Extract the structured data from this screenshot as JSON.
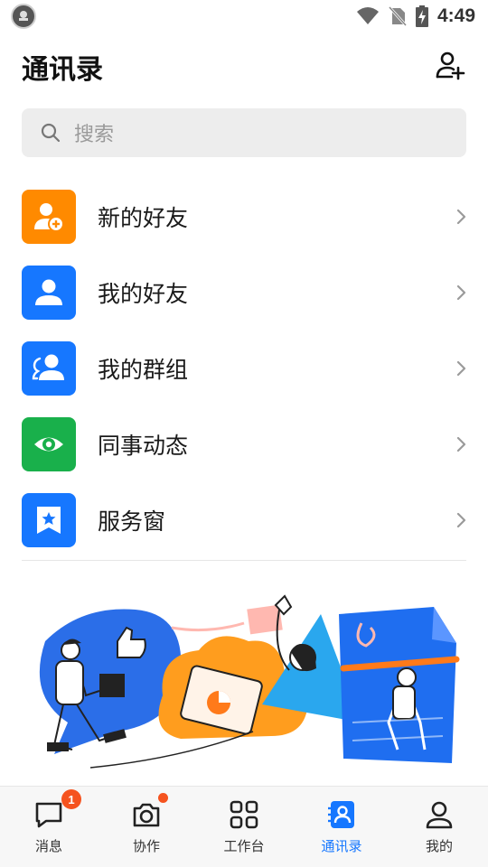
{
  "status_bar": {
    "time": "4:49",
    "icons": [
      "wifi-icon",
      "no-sim-icon",
      "battery-charging-icon"
    ]
  },
  "header": {
    "title": "通讯录",
    "add_contact_icon": "add-person-icon"
  },
  "search": {
    "placeholder": "搜索"
  },
  "menu": [
    {
      "label": "新的好友",
      "icon": "add-friend-icon",
      "color": "#ff8a00"
    },
    {
      "label": "我的好友",
      "icon": "person-icon",
      "color": "#1677ff"
    },
    {
      "label": "我的群组",
      "icon": "group-icon",
      "color": "#1677ff"
    },
    {
      "label": "同事动态",
      "icon": "eye-icon",
      "color": "#19b04b"
    },
    {
      "label": "服务窗",
      "icon": "bookmark-star-icon",
      "color": "#1677ff"
    }
  ],
  "tabs": [
    {
      "label": "消息",
      "icon": "chat-bubble-icon",
      "badge": "1"
    },
    {
      "label": "协作",
      "icon": "collaborate-icon",
      "dot": true
    },
    {
      "label": "工作台",
      "icon": "grid-icon"
    },
    {
      "label": "通讯录",
      "icon": "contacts-icon",
      "active": true
    },
    {
      "label": "我的",
      "icon": "profile-icon"
    }
  ],
  "colors": {
    "accent": "#1677ff",
    "orange": "#ff8a00",
    "green": "#19b04b",
    "badge": "#f5531f"
  }
}
